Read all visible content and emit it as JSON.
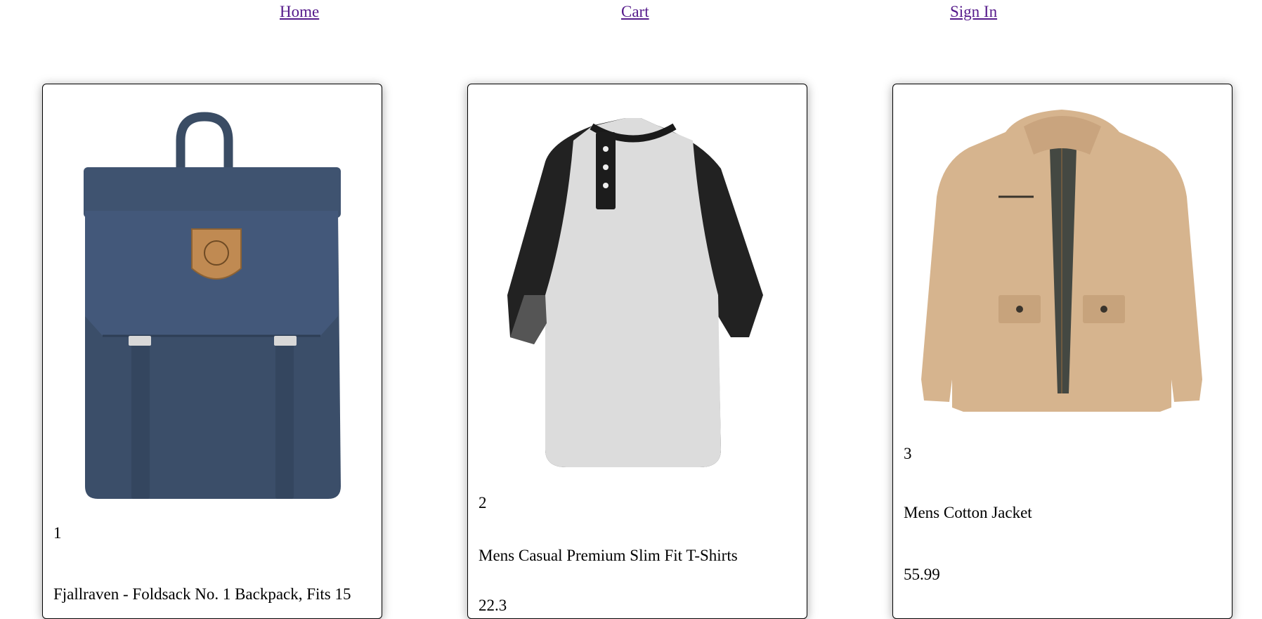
{
  "nav": {
    "home_label": "Home",
    "cart_label": "Cart",
    "signin_label": "Sign In",
    "link_color": "#551a8b"
  },
  "products": [
    {
      "id": "1",
      "title": "Fjallraven - Foldsack No. 1 Backpack, Fits 15",
      "image_icon": "navy-backpack-image"
    },
    {
      "id": "2",
      "title": "Mens Casual Premium Slim Fit T-Shirts",
      "price": "22.3",
      "image_icon": "raglan-tshirt-image"
    },
    {
      "id": "3",
      "title": "Mens Cotton Jacket",
      "price": "55.99",
      "image_icon": "khaki-jacket-image"
    }
  ]
}
